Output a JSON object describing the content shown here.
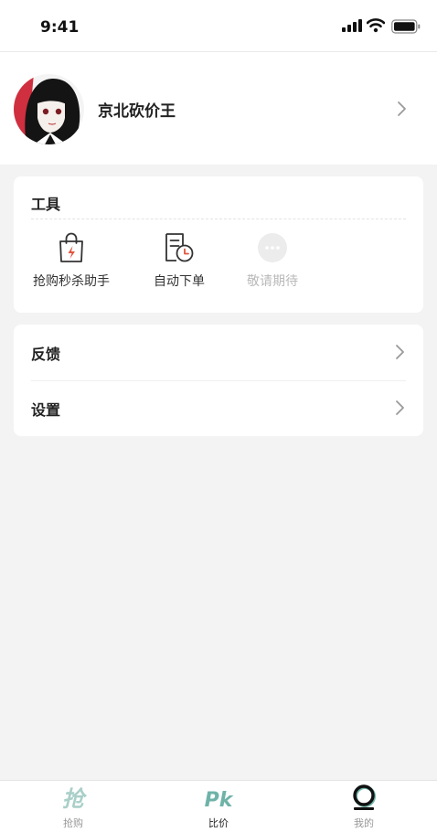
{
  "status_bar": {
    "time": "9:41"
  },
  "profile": {
    "name": "京北砍价王"
  },
  "tools": {
    "title": "工具",
    "items": [
      {
        "label": "抢购秒杀助手",
        "icon": "shopping-bag-icon"
      },
      {
        "label": "自动下单",
        "icon": "order-clock-icon"
      },
      {
        "label": "敬请期待",
        "icon": "more-dots-icon"
      }
    ]
  },
  "menu": {
    "items": [
      {
        "label": "反馈"
      },
      {
        "label": "设置"
      }
    ]
  },
  "tabbar": {
    "items": [
      {
        "label": "抢购",
        "icon_text": "抢"
      },
      {
        "label": "比价",
        "icon_text": "Pk"
      },
      {
        "label": "我的"
      }
    ]
  },
  "colors": {
    "accent": "#6fb3a8",
    "icon_red": "#e0553d",
    "background": "#f3f3f3"
  }
}
